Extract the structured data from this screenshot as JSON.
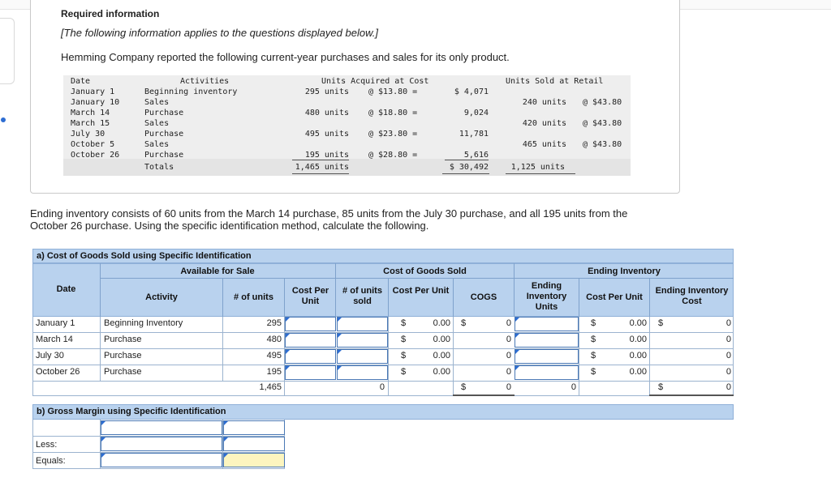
{
  "required": {
    "title": "Required information",
    "note": "[The following information applies to the questions displayed below.]",
    "intro": "Hemming Company reported the following current-year purchases and sales for its only product."
  },
  "info_table": {
    "headers": [
      "Date",
      "Activities",
      "Units Acquired at Cost",
      "Units Sold at Retail"
    ],
    "rows": [
      {
        "date": "January 1",
        "activity": "Beginning inventory",
        "units": "295 units",
        "cost": "@ $13.80 =",
        "total": "$ 4,071",
        "sold": "",
        "retail": ""
      },
      {
        "date": "January 10",
        "activity": "Sales",
        "units": "",
        "cost": "",
        "total": "",
        "sold": "240 units",
        "retail": "@ $43.80"
      },
      {
        "date": "March 14",
        "activity": "Purchase",
        "units": "480 units",
        "cost": "@ $18.80 =",
        "total": "9,024",
        "sold": "",
        "retail": ""
      },
      {
        "date": "March 15",
        "activity": "Sales",
        "units": "",
        "cost": "",
        "total": "",
        "sold": "420 units",
        "retail": "@ $43.80"
      },
      {
        "date": "July 30",
        "activity": "Purchase",
        "units": "495 units",
        "cost": "@ $23.80 =",
        "total": "11,781",
        "sold": "",
        "retail": ""
      },
      {
        "date": "October 5",
        "activity": "Sales",
        "units": "",
        "cost": "",
        "total": "",
        "sold": "465 units",
        "retail": "@ $43.80"
      },
      {
        "date": "October 26",
        "activity": "Purchase",
        "units": "195 units",
        "cost": "@ $28.80 =",
        "total": "5,616",
        "sold": "",
        "retail": ""
      }
    ],
    "totals": {
      "label": "Totals",
      "units": "1,465 units",
      "total": "$ 30,492",
      "sold": "1,125 units"
    }
  },
  "ending_text": "Ending inventory consists of 60 units from the March 14 purchase, 85 units from the July 30 purchase, and all 195 units from the October 26 purchase. Using the specific identification method, calculate the following.",
  "part_a": {
    "title": "a) Cost of Goods Sold using Specific Identification",
    "groups": {
      "available": "Available for Sale",
      "cogs": "Cost of Goods Sold",
      "ending": "Ending Inventory"
    },
    "columns": {
      "date": "Date",
      "activity": "Activity",
      "units": "# of units",
      "cost_per_unit": "Cost Per Unit",
      "units_sold": "# of units sold",
      "cogs_cost_per_unit": "Cost Per Unit",
      "cogs": "COGS",
      "ending_units": "Ending Inventory Units",
      "ending_cost_per_unit": "Cost Per Unit",
      "ending_cost": "Ending Inventory Cost"
    },
    "rows": [
      {
        "date": "January 1",
        "activity": "Beginning Inventory",
        "units": "295",
        "cogs_dollar": "$",
        "cogs_unit_cost": "0.00",
        "cogs_value_dollar": "$",
        "cogs_value": "0",
        "end_dollar": "$",
        "end_unit_cost": "0.00",
        "end_cost_dollar": "$",
        "end_cost": "0"
      },
      {
        "date": "March 14",
        "activity": "Purchase",
        "units": "480",
        "cogs_dollar": "$",
        "cogs_unit_cost": "0.00",
        "cogs_value_dollar": "",
        "cogs_value": "0",
        "end_dollar": "$",
        "end_unit_cost": "0.00",
        "end_cost_dollar": "",
        "end_cost": "0"
      },
      {
        "date": "July 30",
        "activity": "Purchase",
        "units": "495",
        "cogs_dollar": "$",
        "cogs_unit_cost": "0.00",
        "cogs_value_dollar": "",
        "cogs_value": "0",
        "end_dollar": "$",
        "end_unit_cost": "0.00",
        "end_cost_dollar": "",
        "end_cost": "0"
      },
      {
        "date": "October 26",
        "activity": "Purchase",
        "units": "195",
        "cogs_dollar": "$",
        "cogs_unit_cost": "0.00",
        "cogs_value_dollar": "",
        "cogs_value": "0",
        "end_dollar": "$",
        "end_unit_cost": "0.00",
        "end_cost_dollar": "",
        "end_cost": "0"
      }
    ],
    "totals": {
      "units": "1,465",
      "units_sold": "0",
      "cogs_dollar": "$",
      "cogs": "0",
      "ending_units": "0",
      "end_dollar": "$",
      "end_cost": "0"
    }
  },
  "part_b": {
    "title": "b) Gross Margin using Specific Identification",
    "rows": [
      {
        "label": ""
      },
      {
        "label": "Less:"
      },
      {
        "label": "Equals:"
      }
    ]
  }
}
